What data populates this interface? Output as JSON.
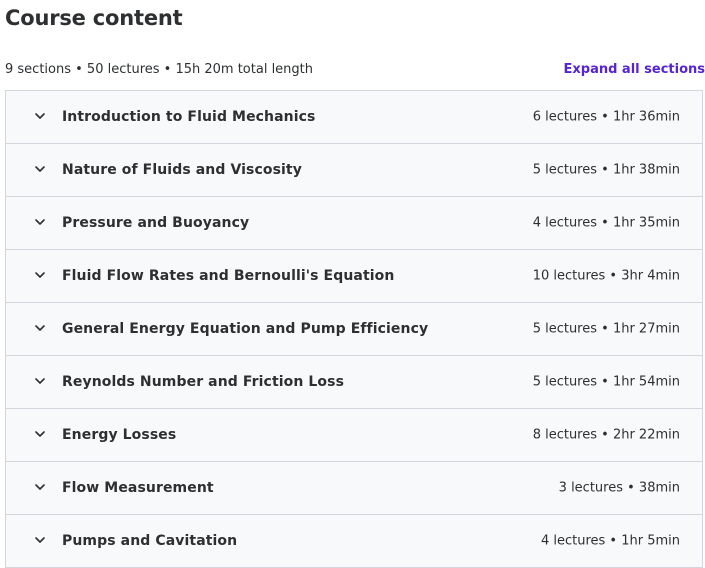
{
  "header": {
    "title": "Course content",
    "summary": "9 sections • 50 lectures • 15h 20m total length",
    "expand_label": "Expand all sections"
  },
  "sections": [
    {
      "title": "Introduction to Fluid Mechanics",
      "meta": "6 lectures • 1hr 36min",
      "icon": "chevron-down-icon"
    },
    {
      "title": "Nature of Fluids and Viscosity",
      "meta": "5 lectures • 1hr 38min",
      "icon": "chevron-down-icon"
    },
    {
      "title": "Pressure and Buoyancy",
      "meta": "4 lectures • 1hr 35min",
      "icon": "chevron-down-icon"
    },
    {
      "title": "Fluid Flow Rates and Bernoulli's Equation",
      "meta": "10 lectures • 3hr 4min",
      "icon": "chevron-down-icon"
    },
    {
      "title": "General Energy Equation and Pump Efficiency",
      "meta": "5 lectures • 1hr 27min",
      "icon": "chevron-down-icon"
    },
    {
      "title": "Reynolds Number and Friction Loss",
      "meta": "5 lectures • 1hr 54min",
      "icon": "chevron-down-icon"
    },
    {
      "title": "Energy Losses",
      "meta": "8 lectures • 2hr 22min",
      "icon": "chevron-down-icon"
    },
    {
      "title": "Flow Measurement",
      "meta": "3 lectures • 38min",
      "icon": "chevron-down-icon"
    },
    {
      "title": "Pumps and Cavitation",
      "meta": "4 lectures • 1hr 5min",
      "icon": "chevron-down-icon"
    }
  ],
  "colors": {
    "text": "#2d2f31",
    "link": "#5624d0",
    "row_bg": "#f7f9fa",
    "border": "#d1d7dc"
  }
}
